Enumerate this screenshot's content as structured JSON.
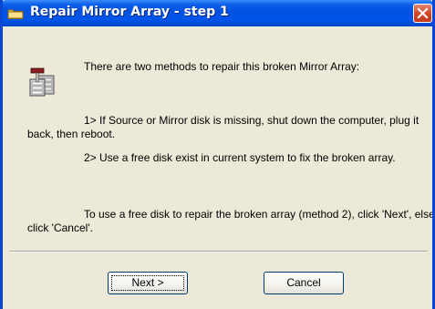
{
  "window": {
    "title": "Repair Mirror Array - step 1"
  },
  "message": {
    "intro": "There are two methods to repair this broken Mirror Array:",
    "method1": "1> If Source or Mirror disk is missing, shut down the computer, plug it back, then reboot.",
    "method2": "2> Use a free disk exist in current system to fix the broken array.",
    "instruction": "To use a free disk to repair the broken array (method 2), click 'Next', else click 'Cancel'."
  },
  "buttons": {
    "next_label": "Next >",
    "cancel_label": "Cancel"
  },
  "icons": {
    "title": "folder-icon",
    "close": "close-icon",
    "app": "disk-repair-icon"
  },
  "colors": {
    "title_bar": "#0055ea",
    "close_button": "#d4452a",
    "dialog_background": "#ece9d8"
  }
}
